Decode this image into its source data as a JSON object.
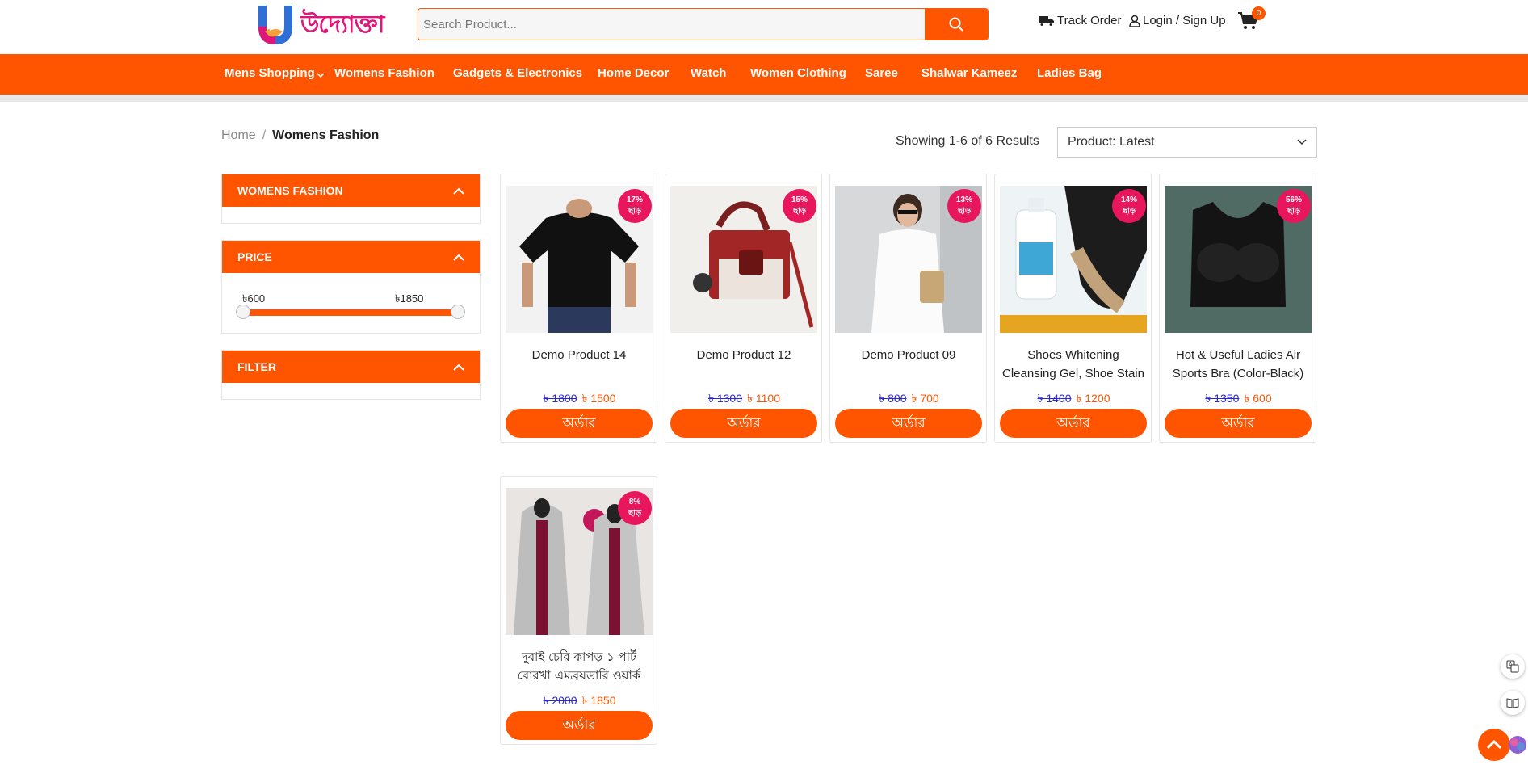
{
  "header": {
    "logo_text": "উদ্যোক্তা",
    "search_placeholder": "Search Product...",
    "track_order": "Track Order",
    "login": "Login / Sign Up",
    "cart_count": "0"
  },
  "nav": {
    "items": [
      "Mens Shopping",
      "Womens Fashion",
      "Gadgets & Electronics",
      "Home Decor",
      "Watch",
      "Women Clothing",
      "Saree",
      "Shalwar Kameez",
      "Ladies Bag"
    ]
  },
  "breadcrumb": {
    "home": "Home",
    "sep": "/",
    "current": "Womens Fashion"
  },
  "results_text": "Showing 1-6 of 6 Results",
  "sort": {
    "selected": "Product: Latest"
  },
  "sidebar": {
    "category_title": "WOMENS FASHION",
    "price_title": "PRICE",
    "price_min": "৳600",
    "price_max": "৳1850",
    "filter_title": "FILTER"
  },
  "products": [
    {
      "name": "Demo Product 14",
      "old_price": "৳ 1800",
      "new_price": "৳ 1500",
      "discount": "17%",
      "discount_label": "ছাড়",
      "button": "অর্ডার"
    },
    {
      "name": "Demo Product 12",
      "old_price": "৳ 1300",
      "new_price": "৳ 1100",
      "discount": "15%",
      "discount_label": "ছাড়",
      "button": "অর্ডার"
    },
    {
      "name": "Demo Product 09",
      "old_price": "৳ 800",
      "new_price": "৳ 700",
      "discount": "13%",
      "discount_label": "ছাড়",
      "button": "অর্ডার"
    },
    {
      "name": "Shoes Whitening Cleansing Gel, Shoe Stain",
      "old_price": "৳ 1400",
      "new_price": "৳ 1200",
      "discount": "14%",
      "discount_label": "ছাড়",
      "button": "অর্ডার"
    },
    {
      "name": "Hot & Useful Ladies Air Sports Bra (Color-Black)",
      "old_price": "৳ 1350",
      "new_price": "৳ 600",
      "discount": "56%",
      "discount_label": "ছাড়",
      "button": "অর্ডার"
    },
    {
      "name": "দুবাই চেরি কাপড় ১ পার্ট বোরখা এমব্রয়ডারি ওয়ার্ক",
      "old_price": "৳ 2000",
      "new_price": "৳ 1850",
      "discount": "8%",
      "discount_label": "ছাড়",
      "button": "অর্ডার"
    }
  ],
  "colors": {
    "accent": "#ff5400",
    "badge": "#e8175d",
    "old_price": "#2a2ad0"
  }
}
